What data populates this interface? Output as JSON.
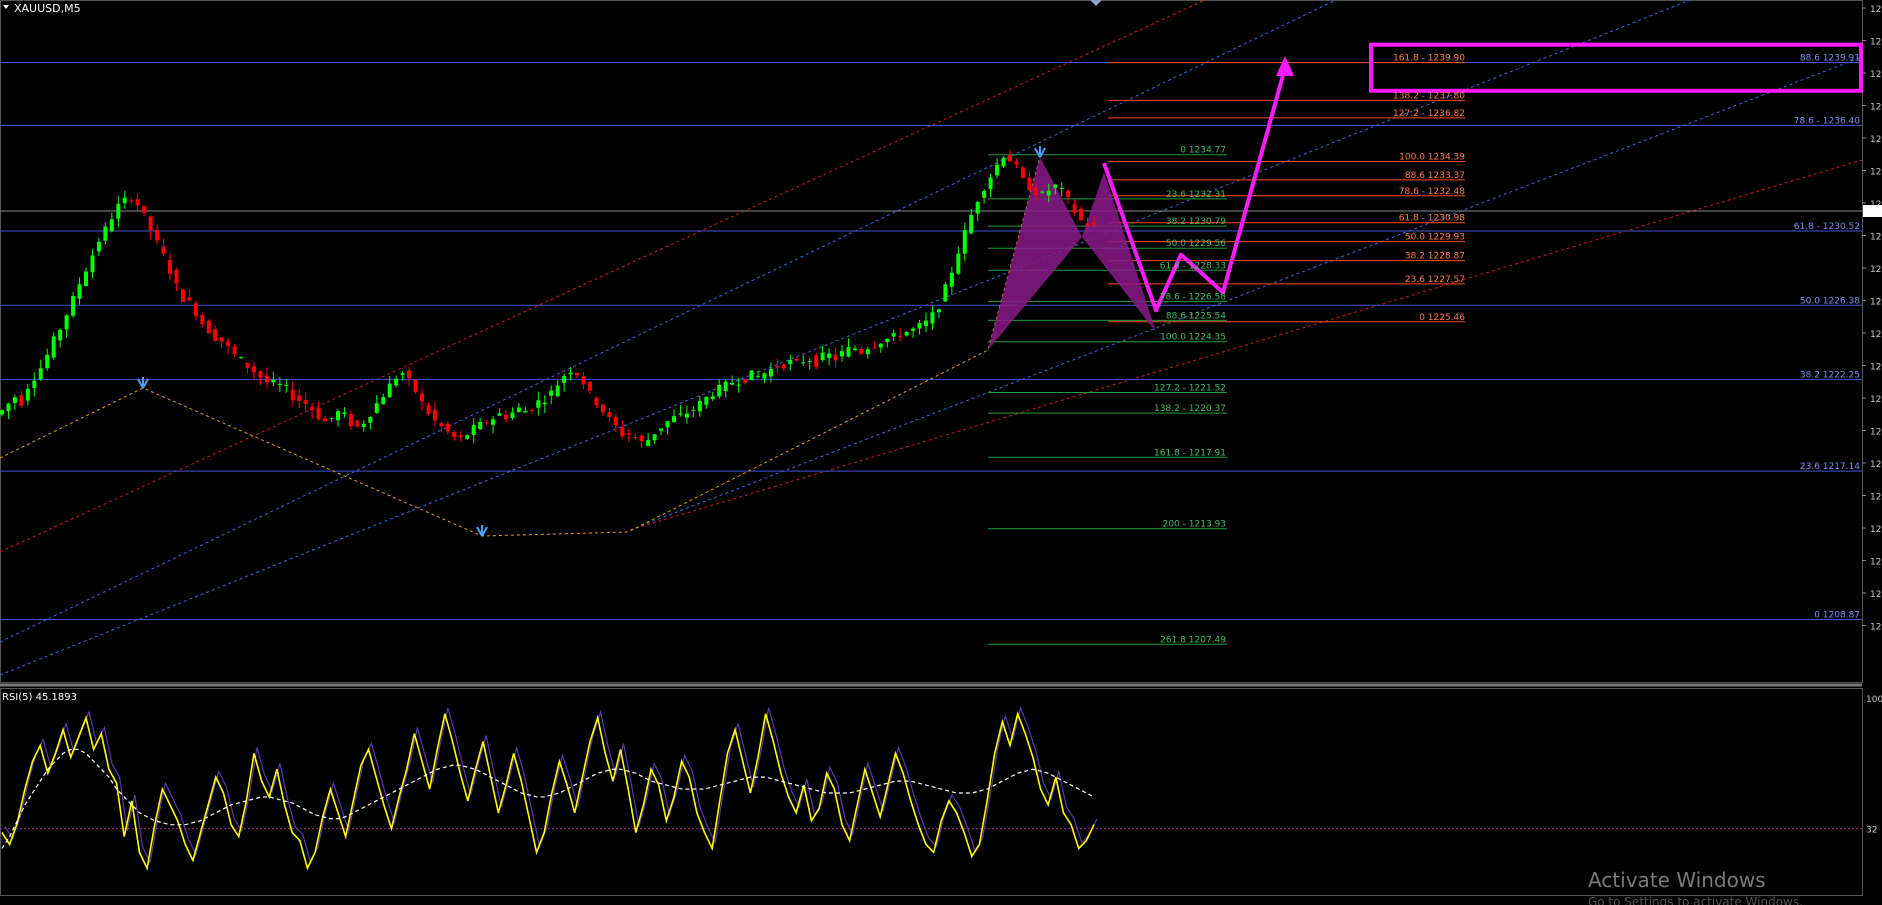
{
  "window": {
    "symbol_title": "XAUUSD,M5",
    "rsi_title": "RSI(5) 45.1893",
    "watermark": "Activate Windows",
    "watermark_sub": "Go to Settings to activate Windows."
  },
  "colors": {
    "background": "#000000",
    "bull_candle": "#00ff00",
    "bear_candle": "#ff0000",
    "fib_blue": "#3f55d8",
    "fib_orange": "#ff4a1a",
    "fib_green": "#1e9e3a",
    "pattern_fill": "#8a1a8a",
    "projection": "#ff1aff",
    "rsi_line": "#ffff00",
    "rsi_signal": "#ffffff",
    "rsi_band": "#5a3aa8",
    "channel_blue": "#3a6ad8",
    "channel_red": "#c81e1e"
  },
  "chart_data": [
    {
      "type": "candlestick",
      "symbol": "XAUUSD",
      "timeframe": "M5",
      "ylim": [
        1206.0,
        1242.0
      ],
      "price_axis_labels": [
        "12",
        "12",
        "12",
        "12",
        "12",
        "12",
        "12",
        "12",
        "12",
        "12",
        "12",
        "12",
        "12",
        "12",
        "12",
        "12",
        "12",
        "12",
        "12",
        "12"
      ],
      "ohlc_path": [
        1220.5,
        1220.9,
        1221.3,
        1221.0,
        1221.9,
        1222.4,
        1222.9,
        1223.6,
        1224.4,
        1225.1,
        1225.9,
        1226.7,
        1227.6,
        1228.4,
        1229.2,
        1230.0,
        1230.6,
        1231.3,
        1231.9,
        1232.2,
        1232.4,
        1232.0,
        1231.3,
        1230.6,
        1229.8,
        1229.1,
        1228.3,
        1227.4,
        1226.8,
        1226.5,
        1226.0,
        1225.4,
        1225.0,
        1224.6,
        1224.4,
        1224.0,
        1223.6,
        1223.3,
        1223.0,
        1222.7,
        1222.4,
        1222.1,
        1222.0,
        1221.9,
        1221.7,
        1221.3,
        1221.1,
        1220.9,
        1220.6,
        1220.2,
        1219.9,
        1220.1,
        1220.4,
        1220.2,
        1219.8,
        1219.6,
        1219.9,
        1220.4,
        1220.9,
        1221.4,
        1221.9,
        1222.4,
        1222.6,
        1222.1,
        1221.6,
        1220.9,
        1220.4,
        1219.9,
        1219.6,
        1219.3,
        1219.0,
        1218.9,
        1219.2,
        1219.5,
        1219.7,
        1219.9,
        1220.1,
        1220.3,
        1220.2,
        1220.4,
        1220.6,
        1220.5,
        1220.7,
        1221.0,
        1221.2,
        1221.5,
        1222.0,
        1222.5,
        1222.8,
        1222.6,
        1222.1,
        1221.4,
        1221.0,
        1220.5,
        1220.0,
        1219.6,
        1219.2,
        1219.2,
        1219.0,
        1218.7,
        1218.9,
        1219.3,
        1219.6,
        1219.9,
        1220.1,
        1220.2,
        1220.4,
        1220.6,
        1220.9,
        1221.2,
        1221.5,
        1221.7,
        1221.9,
        1222.1,
        1222.2,
        1222.3,
        1222.5,
        1222.4,
        1222.6,
        1222.8,
        1223.0,
        1223.1,
        1223.2,
        1223.1,
        1223.3,
        1223.4,
        1223.2,
        1223.5,
        1223.6,
        1223.4,
        1223.7,
        1223.9,
        1224.0,
        1223.8,
        1224.1,
        1224.2,
        1224.4,
        1224.5,
        1224.6,
        1224.8,
        1224.9,
        1225.0,
        1225.2,
        1225.4,
        1225.8,
        1226.4,
        1227.3,
        1228.3,
        1229.4,
        1230.4,
        1231.4,
        1232.3,
        1233.0,
        1233.6,
        1234.2,
        1234.8,
        1234.5,
        1234.0,
        1233.3,
        1233.0,
        1232.7,
        1232.5,
        1232.8,
        1233.0,
        1232.7,
        1232.2,
        1231.6,
        1231.1,
        1230.9,
        1230.7
      ],
      "fib_levels": [
        {
          "group": "blue",
          "name": "fib-blue-886",
          "label": "88.6 1239.91",
          "price": 1239.91
        },
        {
          "group": "blue",
          "name": "fib-blue-786",
          "label": "78.6 - 1236.40",
          "price": 1236.4
        },
        {
          "group": "blue",
          "name": "fib-blue-618",
          "label": "61.8 - 1230.52",
          "price": 1230.52
        },
        {
          "group": "blue",
          "name": "fib-blue-500",
          "label": "50.0 1226.38",
          "price": 1226.38
        },
        {
          "group": "blue",
          "name": "fib-blue-382",
          "label": "38.2 1222.25",
          "price": 1222.25
        },
        {
          "group": "blue",
          "name": "fib-blue-236",
          "label": "23.6 1217.14",
          "price": 1217.14
        },
        {
          "group": "blue",
          "name": "fib-blue-0",
          "label": "0 1208.87",
          "price": 1208.87
        },
        {
          "group": "orange",
          "name": "fib-orange-1618",
          "label": "161.8 - 1239.90",
          "price": 1239.9
        },
        {
          "group": "orange",
          "name": "fib-orange-1382",
          "label": "138.2 - 1237.80",
          "price": 1237.8
        },
        {
          "group": "orange",
          "name": "fib-orange-1272",
          "label": "127.2 - 1236.82",
          "price": 1236.82
        },
        {
          "group": "orange",
          "name": "fib-orange-1000",
          "label": "100.0 1234.39",
          "price": 1234.39
        },
        {
          "group": "orange",
          "name": "fib-orange-886",
          "label": "88.6 1233.37",
          "price": 1233.37
        },
        {
          "group": "orange",
          "name": "fib-orange-786",
          "label": "78.6 - 1232.48",
          "price": 1232.48
        },
        {
          "group": "orange",
          "name": "fib-orange-618",
          "label": "61.8 - 1230.98",
          "price": 1230.98
        },
        {
          "group": "orange",
          "name": "fib-orange-500",
          "label": "50.0 1229.93",
          "price": 1229.93
        },
        {
          "group": "orange",
          "name": "fib-orange-382",
          "label": "38.2 1228.87",
          "price": 1228.87
        },
        {
          "group": "orange",
          "name": "fib-orange-236",
          "label": "23.6 1227.57",
          "price": 1227.57
        },
        {
          "group": "orange",
          "name": "fib-orange-0",
          "label": "0 1225.46",
          "price": 1225.46
        },
        {
          "group": "green",
          "name": "fib-green-0",
          "label": "0 1234.77",
          "price": 1234.77
        },
        {
          "group": "green",
          "name": "fib-green-236",
          "label": "23.6 1232.31",
          "price": 1232.31
        },
        {
          "group": "green",
          "name": "fib-green-382",
          "label": "38.2 1230.79",
          "price": 1230.79
        },
        {
          "group": "green",
          "name": "fib-green-500",
          "label": "50.0 1229.56",
          "price": 1229.56
        },
        {
          "group": "green",
          "name": "fib-green-618",
          "label": "61.8 - 1228.33",
          "price": 1228.33
        },
        {
          "group": "green",
          "name": "fib-green-786",
          "label": "78.6 - 1226.58",
          "price": 1226.58
        },
        {
          "group": "green",
          "name": "fib-green-886",
          "label": "88.6 1225.54",
          "price": 1225.54
        },
        {
          "group": "green",
          "name": "fib-green-1000",
          "label": "100.0 1224.35",
          "price": 1224.35
        },
        {
          "group": "green",
          "name": "fib-green-1272",
          "label": "127.2 - 1221.52",
          "price": 1221.52
        },
        {
          "group": "green",
          "name": "fib-green-1382",
          "label": "138.2 - 1220.37",
          "price": 1220.37
        },
        {
          "group": "green",
          "name": "fib-green-1618",
          "label": "161.8 - 1217.91",
          "price": 1217.91
        },
        {
          "group": "green",
          "name": "fib-green-200",
          "label": "200 - 1213.93",
          "price": 1213.93
        },
        {
          "group": "green",
          "name": "fib-green-2618",
          "label": "261.8 1207.49",
          "price": 1207.49
        }
      ],
      "projection_path_prices": [
        1234.3,
        1226.1,
        1229.2,
        1227.1,
        1239.6
      ],
      "highlight_box_prices": [
        1239.0,
        1240.9
      ]
    },
    {
      "type": "line",
      "indicator": "RSI",
      "period": 5,
      "current_value": 45.1893,
      "ylim": [
        0,
        100
      ],
      "level_line": 32,
      "axis_labels": [
        "100",
        "32"
      ],
      "series": [
        {
          "role": "rsi",
          "values": [
            30,
            24,
            35,
            52,
            66,
            74,
            60,
            70,
            82,
            68,
            78,
            88,
            72,
            80,
            62,
            55,
            28,
            46,
            20,
            12,
            34,
            52,
            44,
            36,
            24,
            16,
            30,
            44,
            58,
            50,
            34,
            28,
            46,
            70,
            56,
            48,
            62,
            44,
            30,
            26,
            12,
            20,
            38,
            52,
            40,
            28,
            46,
            64,
            72,
            58,
            44,
            32,
            48,
            62,
            80,
            66,
            52,
            72,
            90,
            76,
            60,
            46,
            62,
            76,
            58,
            40,
            54,
            70,
            56,
            38,
            20,
            30,
            50,
            66,
            54,
            40,
            58,
            76,
            88,
            70,
            56,
            72,
            52,
            30,
            44,
            62,
            54,
            36,
            48,
            66,
            58,
            40,
            30,
            22,
            46,
            70,
            82,
            66,
            50,
            68,
            90,
            76,
            60,
            48,
            40,
            54,
            36,
            42,
            60,
            52,
            34,
            26,
            44,
            62,
            50,
            38,
            54,
            70,
            60,
            46,
            34,
            24,
            20,
            36,
            46,
            40,
            30,
            18,
            24,
            46,
            70,
            86,
            74,
            90,
            80,
            68,
            52,
            44,
            58,
            40,
            34,
            22,
            26,
            34
          ]
        },
        {
          "role": "signal",
          "values": [
            22,
            28,
            36,
            44,
            50,
            56,
            62,
            66,
            70,
            72,
            72,
            70,
            66,
            62,
            58,
            52,
            48,
            44,
            40,
            38,
            36,
            35,
            34,
            34,
            34,
            35,
            36,
            38,
            40,
            42,
            44,
            45,
            46,
            47,
            48,
            48,
            47,
            46,
            45,
            43,
            41,
            39,
            38,
            37,
            37,
            38,
            40,
            42,
            44,
            46,
            48,
            50,
            52,
            54,
            56,
            58,
            60,
            62,
            63,
            64,
            64,
            63,
            62,
            60,
            58,
            56,
            54,
            52,
            50,
            49,
            48,
            48,
            49,
            50,
            52,
            54,
            56,
            58,
            60,
            61,
            62,
            62,
            61,
            60,
            58,
            56,
            55,
            54,
            53,
            52,
            52,
            52,
            52,
            53,
            54,
            55,
            56,
            57,
            58,
            58,
            58,
            57,
            56,
            55,
            54,
            53,
            52,
            51,
            50,
            50,
            50,
            50,
            51,
            52,
            53,
            54,
            55,
            56,
            56,
            56,
            55,
            54,
            53,
            52,
            51,
            50,
            50,
            50,
            51,
            52,
            54,
            56,
            58,
            60,
            61,
            62,
            61,
            60,
            58,
            56,
            54,
            52,
            50,
            48
          ]
        }
      ]
    }
  ]
}
